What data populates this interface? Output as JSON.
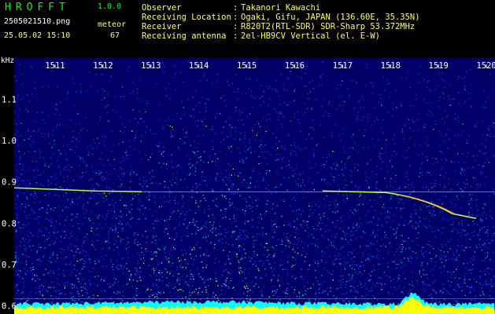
{
  "header": {
    "app_title": "HROFFT",
    "app_version": "1.0.0",
    "file_name": "2505021510.png",
    "mode": "meteor",
    "timestamp": "25.05.02 15:10",
    "meteor_count": "67",
    "info": [
      {
        "label": "Observer",
        "value": "Takanori Kawachi"
      },
      {
        "label": "Receiving Location",
        "value": "Ogaki, Gifu, JAPAN (136.60E, 35.35N)"
      },
      {
        "label": "Receiver",
        "value": "R820T2(RTL-SDR) SDR-Sharp 53.372MHz"
      },
      {
        "label": "Receiving antenna",
        "value": "2el-HB9CV Vertical (el. E-W)"
      }
    ]
  },
  "chart_data": {
    "type": "heatmap",
    "ylabel": "kHz",
    "x_ticks": [
      "1511",
      "1512",
      "1513",
      "1514",
      "1515",
      "1516",
      "1517",
      "1518",
      "1519",
      "1520"
    ],
    "y_ticks": [
      "1.1",
      "1.0",
      "0.9",
      "0.8",
      "0.7",
      "0.6"
    ],
    "ylim": [
      0.58,
      1.2
    ],
    "carrier_freq": 0.88,
    "colors": {
      "text_label": "#ffff66",
      "title": "#00ff00",
      "background": "#000066",
      "signal": "#ffff00",
      "floor": "#00ffff"
    }
  }
}
